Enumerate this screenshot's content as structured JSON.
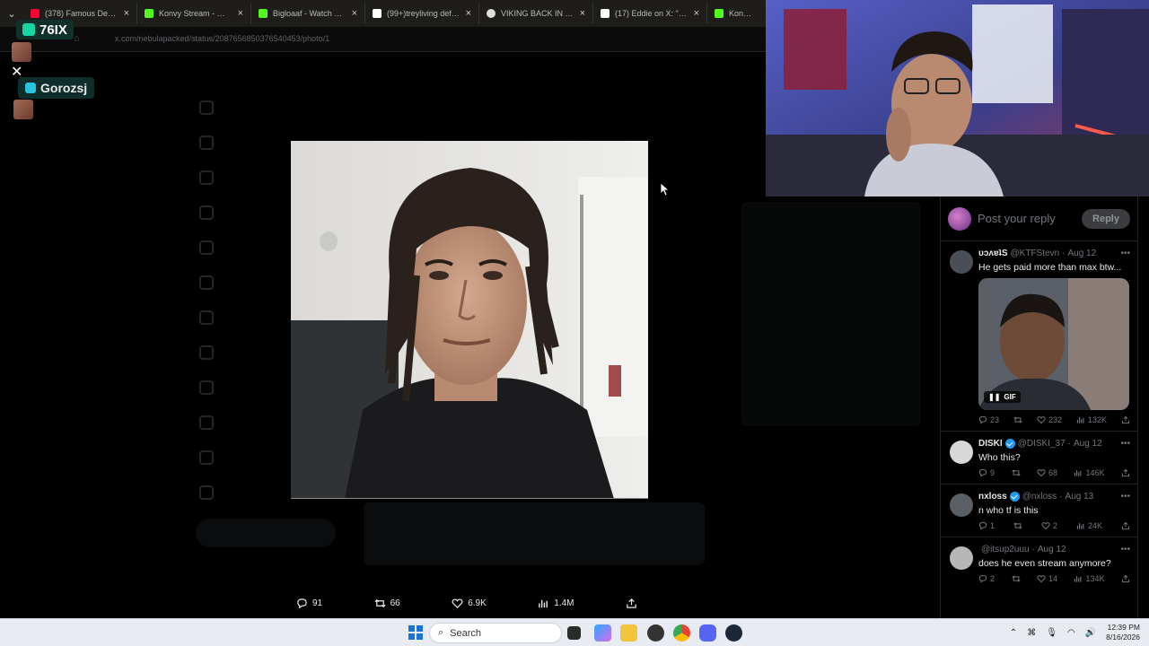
{
  "browser": {
    "tabs": [
      {
        "title": "(378) Famous Dex - L",
        "favicon_color": "#ff0033"
      },
      {
        "title": "Konvy Stream - Watch",
        "favicon_color": "#53fc18"
      },
      {
        "title": "Bigloaaf - Watch clips",
        "favicon_color": "#53fc18"
      },
      {
        "title": "(99+)treyliving defend",
        "favicon_color": "#ffffff"
      },
      {
        "title": "VIKING BACK IN THE L",
        "favicon_color": "#dddddd"
      },
      {
        "title": "(17) Eddie on X: \"Shou",
        "favicon_color": "#ffffff"
      },
      {
        "title": "Konvy Strea",
        "favicon_color": "#53fc18"
      }
    ],
    "url": "x.com/nebulapacked/status/2087656850376540453/photo/1"
  },
  "overlay": {
    "badge_76": "76IX",
    "badge_gorozsj": "Gorozsj"
  },
  "photo_actions": {
    "replies": "91",
    "reposts": "66",
    "likes": "6.9K",
    "views": "1.4M"
  },
  "reply_panel": {
    "compose_placeholder": "Post your reply",
    "reply_button": "Reply",
    "tweets": [
      {
        "name": "ᴜᴐʌɐʇS",
        "handle": "@KTFStevn",
        "date": "Aug 12",
        "text": "He gets paid more than max btw...",
        "has_gif": true,
        "gif_label": "GIF",
        "replies": "23",
        "reposts": "",
        "likes": "232",
        "views": "132K",
        "verified": false,
        "avatar_color": "#4a4f57"
      },
      {
        "name": "DISKI",
        "handle": "@DISKI_37",
        "date": "Aug 12",
        "text": "Who this?",
        "replies": "9",
        "reposts": "",
        "likes": "68",
        "views": "146K",
        "verified": true,
        "avatar_color": "#d8d8d8"
      },
      {
        "name": "nxloss",
        "handle": "@nxloss",
        "date": "Aug 13",
        "text": "n who tf is this",
        "replies": "1",
        "reposts": "",
        "likes": "2",
        "views": "24K",
        "verified": true,
        "avatar_color": "#5a5f66"
      },
      {
        "name": "",
        "handle": "@itsup2uuu",
        "date": "Aug 12",
        "text": "does he even stream anymore?",
        "replies": "2",
        "reposts": "",
        "likes": "14",
        "views": "134K",
        "verified": false,
        "avatar_color": "#b7b7b7"
      }
    ]
  },
  "taskbar": {
    "search_label": "Search",
    "time": "12:39 PM",
    "date": "8/16/2026"
  },
  "colors": {
    "x_blue": "#1d9bf0",
    "kick_green": "#53fc18",
    "panel_border": "#1f2226"
  }
}
